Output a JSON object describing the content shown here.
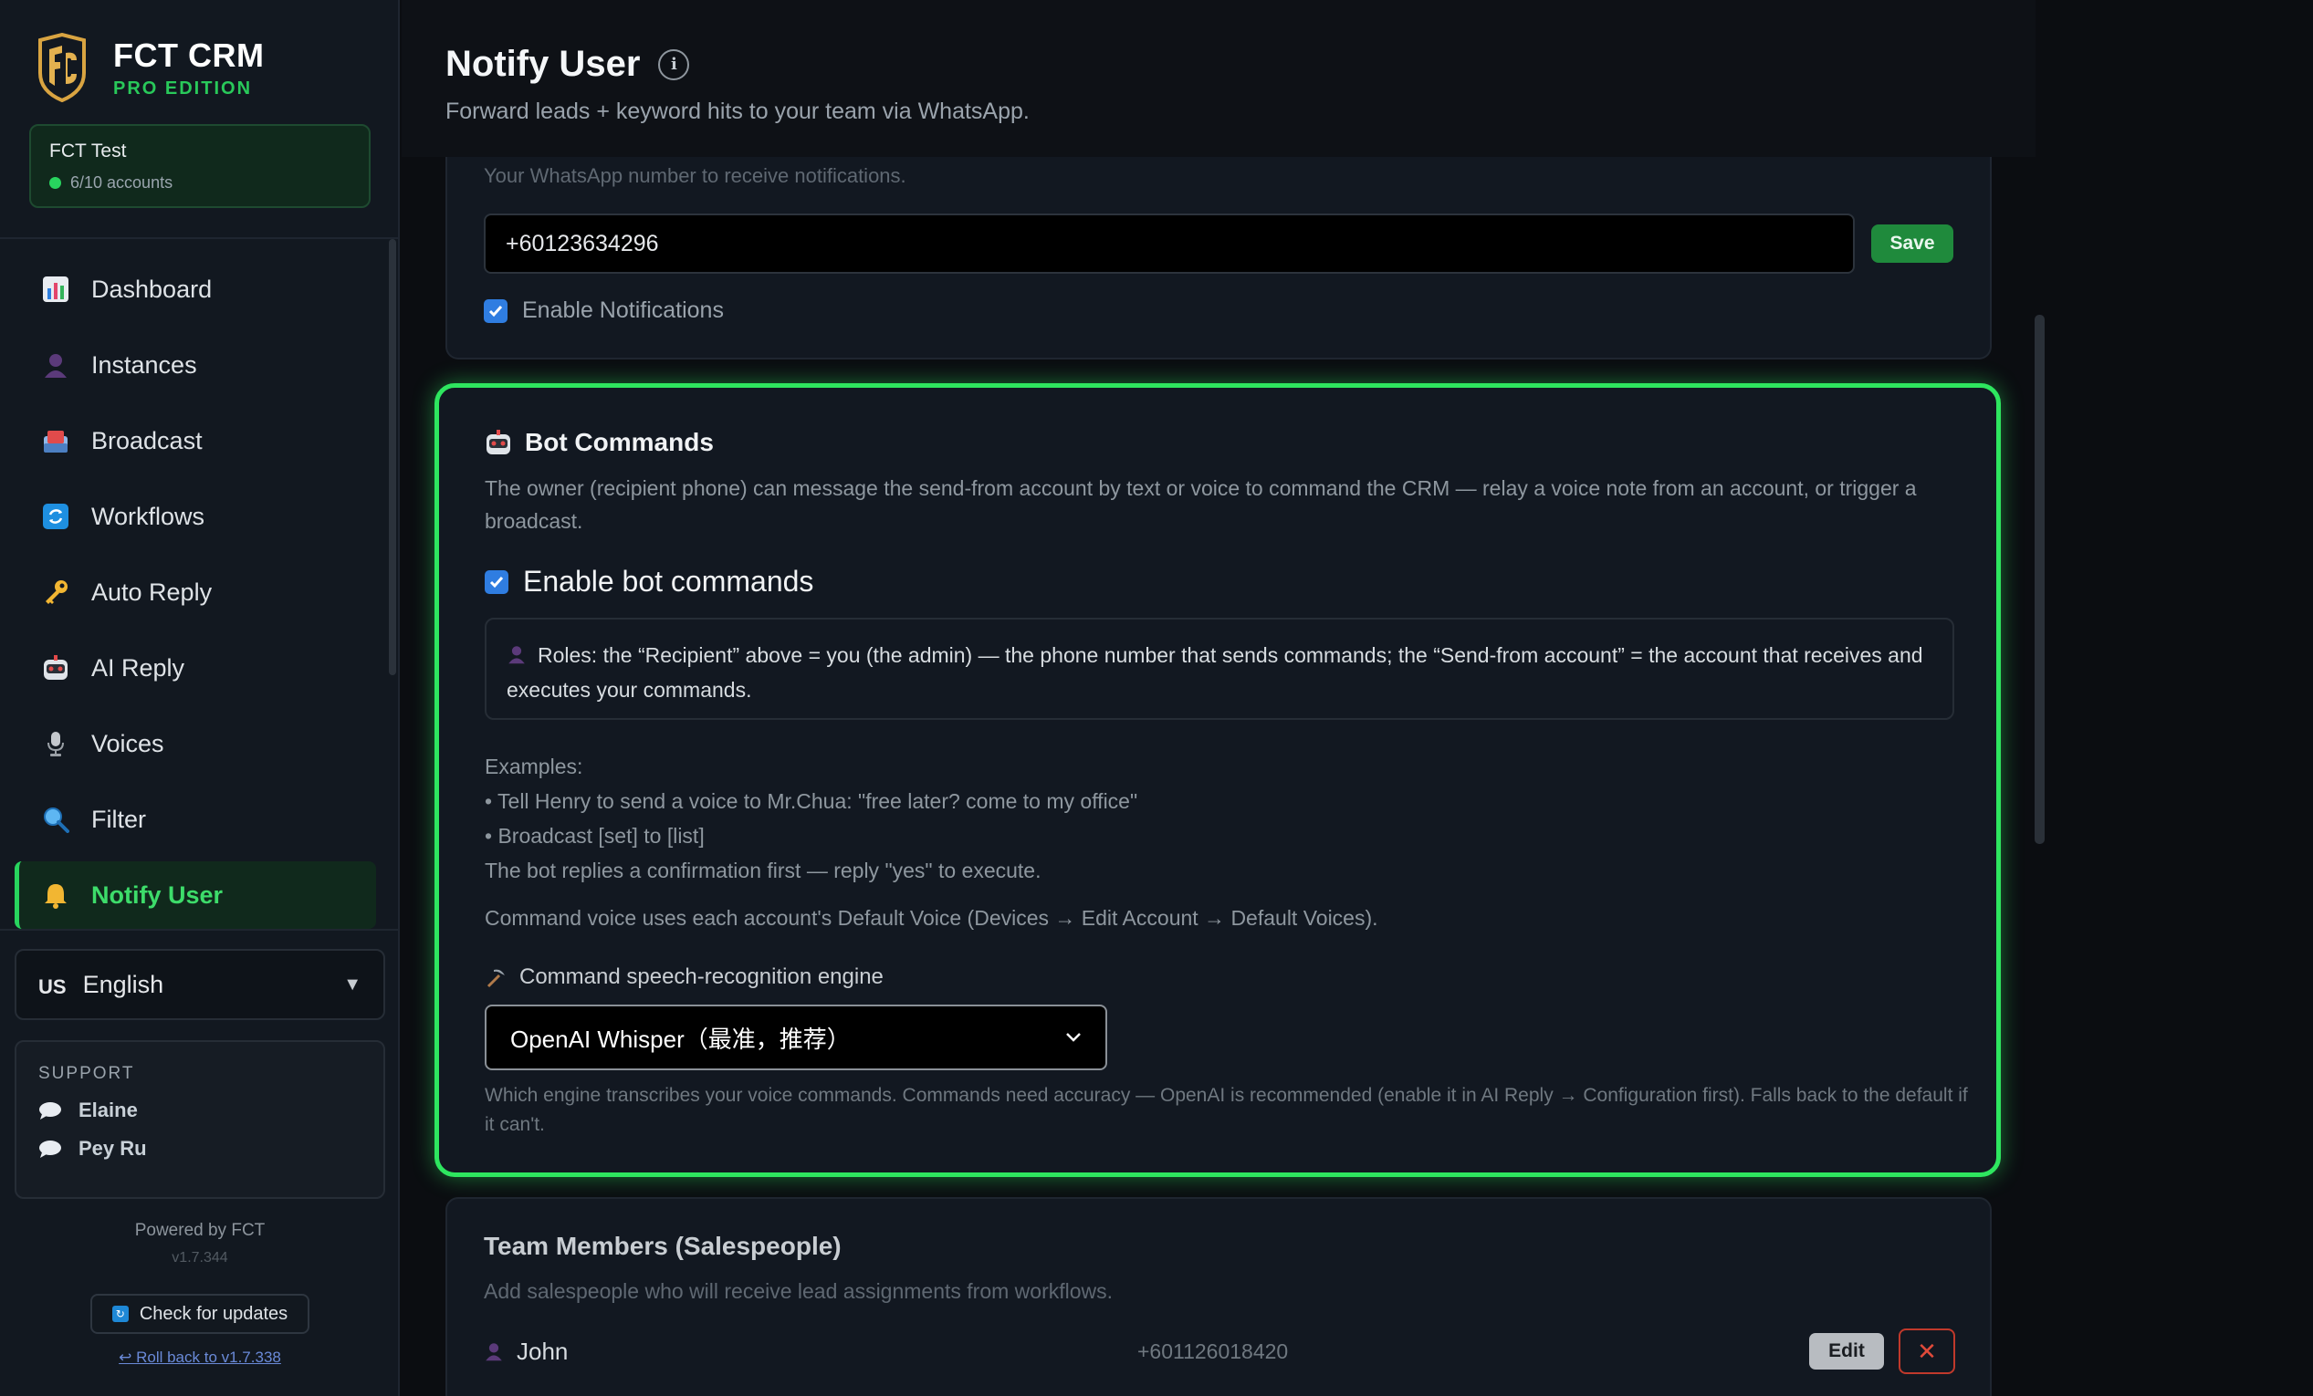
{
  "brand": {
    "name": "FCT CRM",
    "edition": "PRO EDITION"
  },
  "account": {
    "name": "FCT Test",
    "status": "6/10 accounts"
  },
  "nav": {
    "items": [
      {
        "label": "Dashboard",
        "icon": "bar-chart-icon"
      },
      {
        "label": "Instances",
        "icon": "person-icon"
      },
      {
        "label": "Broadcast",
        "icon": "inbox-icon"
      },
      {
        "label": "Workflows",
        "icon": "refresh-icon"
      },
      {
        "label": "Auto Reply",
        "icon": "key-icon"
      },
      {
        "label": "AI Reply",
        "icon": "robot-icon"
      },
      {
        "label": "Voices",
        "icon": "microphone-icon"
      },
      {
        "label": "Filter",
        "icon": "magnifier-icon"
      },
      {
        "label": "Notify User",
        "icon": "bell-icon",
        "active": true
      }
    ]
  },
  "language": {
    "flag": "US",
    "label": "English"
  },
  "support": {
    "title": "SUPPORT",
    "contacts": [
      "Elaine",
      "Pey Ru"
    ]
  },
  "footer": {
    "powered": "Powered by FCT",
    "version": "v1.7.344",
    "update_label": "Check for updates",
    "rollback_label": "↩ Roll back to v1.7.338"
  },
  "page": {
    "title": "Notify User",
    "subtitle": "Forward leads + keyword hits to your team via WhatsApp."
  },
  "whatsapp": {
    "hint": "Your WhatsApp number to receive notifications.",
    "number": "+60123634296",
    "save_label": "Save",
    "enable_label": "Enable Notifications",
    "enabled": true
  },
  "bot": {
    "title": "Bot Commands",
    "description": "The owner (recipient phone) can message the send-from account by text or voice to command the CRM — relay a voice note from an account, or trigger a broadcast.",
    "enable_label": "Enable bot commands",
    "enabled": true,
    "roles": "Roles: the “Recipient” above = you (the admin) — the phone number that sends commands; the “Send-from account” = the account that receives and executes your commands.",
    "examples_title": "Examples:",
    "examples": [
      "• Tell Henry to send a voice to Mr.Chua: \"free later? come to my office\"",
      "• Broadcast [set] to [list]",
      "The bot replies a confirmation first — reply \"yes\" to execute."
    ],
    "voice_note": "Command voice uses each account's Default Voice (Devices → Edit Account → Default Voices).",
    "engine_label": "Command speech-recognition engine",
    "engine_value": "OpenAI Whisper（最准，推荐）",
    "engine_help": "Which engine transcribes your voice commands. Commands need accuracy — OpenAI is recommended (enable it in AI Reply → Configuration first). Falls back to the default if it can't."
  },
  "team": {
    "title": "Team Members (Salespeople)",
    "description": "Add salespeople who will receive lead assignments from workflows.",
    "members": [
      {
        "name": "John",
        "phone": "+601126018420"
      }
    ],
    "edit_label": "Edit",
    "delete_label": "✕"
  },
  "colors": {
    "accent_green": "#2ee65f",
    "save_green": "#1f8a3c",
    "checkbox_blue": "#2f7de1",
    "danger_red": "#e04a3a"
  }
}
